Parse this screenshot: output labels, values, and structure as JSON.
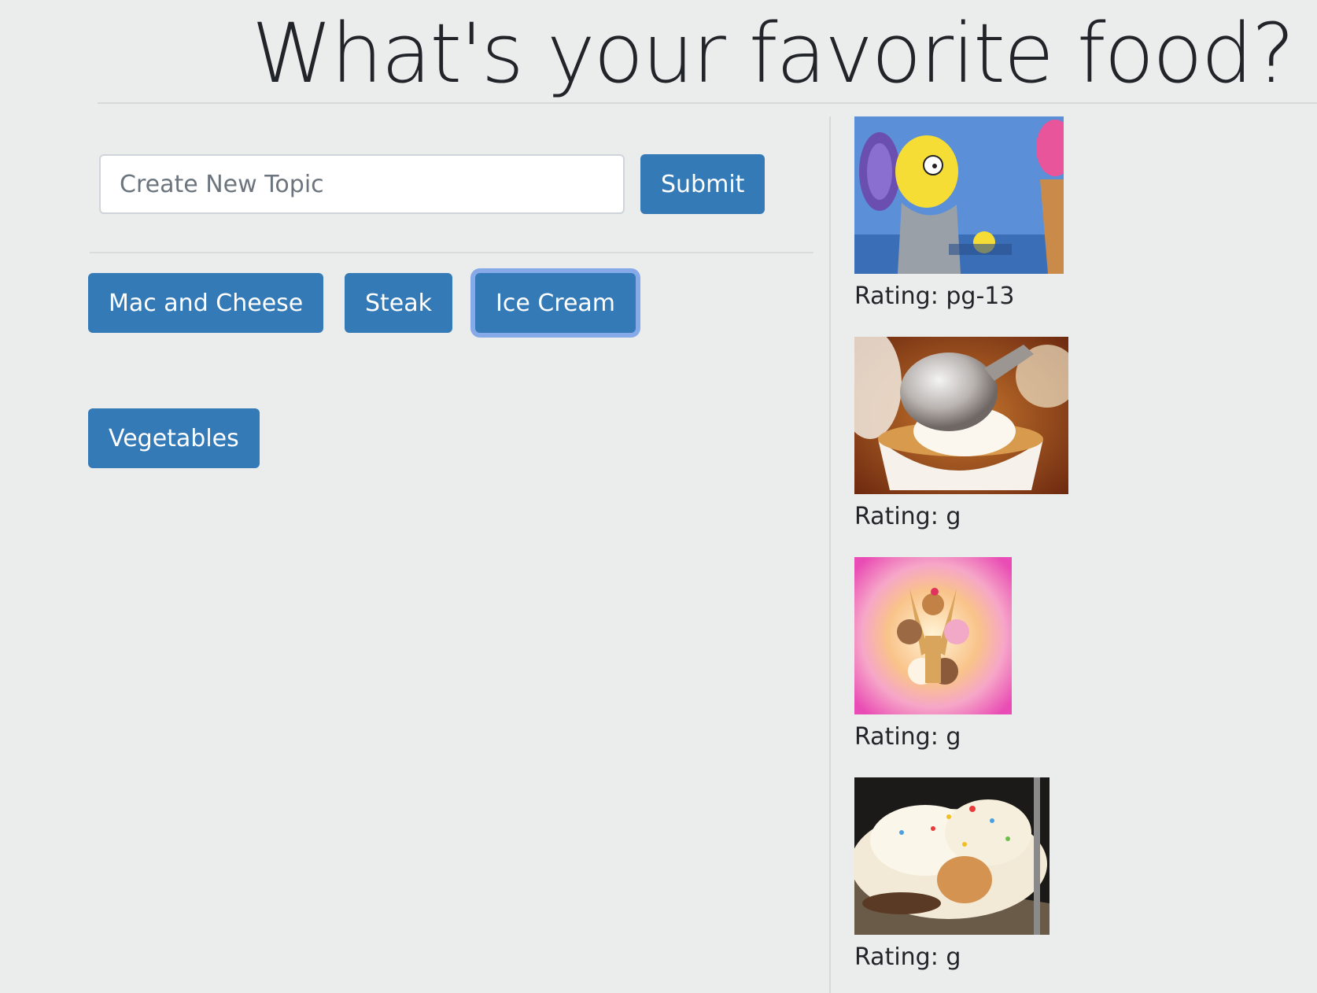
{
  "header": {
    "title": "What's your favorite food?"
  },
  "form": {
    "input_placeholder": "Create New Topic",
    "input_value": "",
    "submit_label": "Submit"
  },
  "topics": [
    {
      "label": "Mac and Cheese",
      "focused": false
    },
    {
      "label": "Steak",
      "focused": false
    },
    {
      "label": "Ice Cream",
      "focused": true
    },
    {
      "label": "Vegetables",
      "focused": false
    }
  ],
  "gifs": [
    {
      "rating_text": "Rating: pg-13",
      "subject": "cartoon character eating ice cream"
    },
    {
      "rating_text": "Rating: g",
      "subject": "ice cream scoop in bowl"
    },
    {
      "rating_text": "Rating: g",
      "subject": "cartoon ice cream sundae"
    },
    {
      "rating_text": "Rating: g",
      "subject": "ice cream sundae with sprinkles"
    }
  ],
  "colors": {
    "background": "#ebecec",
    "primary_button": "#337ab7",
    "focus_ring": "#86a9e8"
  }
}
